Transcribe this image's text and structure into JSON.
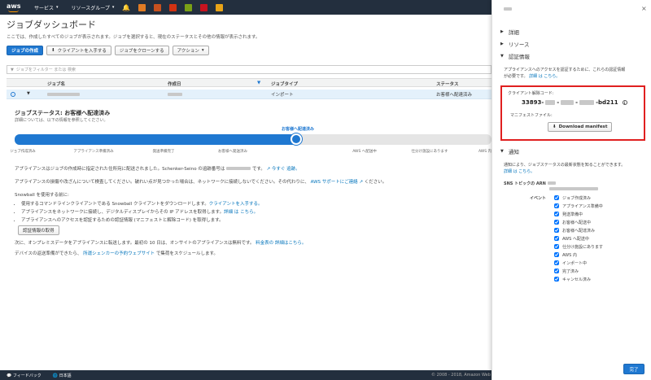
{
  "nav": {
    "services": "サービス",
    "resource_groups": "リソースグループ",
    "service_icon_colors": [
      "#e07b24",
      "#c7511f",
      "#d13212",
      "#7aa116",
      "#c7131f",
      "#e8a317"
    ]
  },
  "page": {
    "title": "ジョブダッシュボード",
    "description": "ここでは、作成したすべてのジョブが表示されます。ジョブを選択すると、現在のステータスとその他の情報が表示されます。",
    "buttons": {
      "create_job": "ジョブの作成",
      "get_client": "クライアントを入手する",
      "clone_job": "ジョブをクローンする",
      "actions": "アクション"
    },
    "filter_placeholder": "ジョブをフィルター または 検索",
    "table": {
      "headers": [
        "ジョブ名",
        "作成日",
        "ジョブタイプ",
        "ステータス"
      ],
      "row": {
        "type": "インポート",
        "status": "お客様へ配達済み"
      }
    }
  },
  "detail": {
    "status_title": "ジョブステータス: お客様へ配達済み",
    "status_sub": "詳細については、以下の情報を参照してください。",
    "current_stage": "お客様へ配達済み",
    "progress_fraction": 0.59,
    "stages": [
      "ジョブ作成済み",
      "アプライアンス準備済み",
      "発送準備完了",
      "お客様へ発送済み",
      "AWS へ配送中",
      "仕分け施設にあります",
      "AWS 内"
    ],
    "para1_a": "アプライアンスはジョブの作成時に指定された住所宛に配送されました。Schenker-Seino の追跡番号は",
    "para1_b": "です。",
    "para1_link1": "今すぐ",
    "para1_link2": "追跡。",
    "para2": "アプライアンスの損傷や改ざんについて検査してください。破れい点が見つかった場合は、ネットワークに接続しないでください。その代わりに、",
    "para2_link": "AWS サポートにご連絡",
    "para2_end": "ください。",
    "before_title": "Snowball を使用する前に:",
    "bullets": [
      {
        "text": "使用するコマンドラインクライアントである Snowball クライアントをダウンロードします。",
        "link": "クライアントを入手する。"
      },
      {
        "text": "アプライアンスをネットワークに接続し、デジタルディスプレイからその IP アドレスを取得します。",
        "link": "詳細 は こちら。"
      },
      {
        "text": "アプライアンスへのアクセスを認証するための認証情報 (マニフェストと解除コード) を取得します。",
        "link": ""
      }
    ],
    "get_credentials": "認証情報の取得",
    "para3": "次に、オンプレミスデータをアプライアンスに転送します。最初の 10 日は、オンサイトのアプライアンスは無料です。",
    "para3_link": "料金表の 詳細はこちら。",
    "para4": "デバイスの返送準備ができたら、",
    "para4_link": "所運シェンカーの予約ウェブサイト",
    "para4_end": "で集荷をスケジュールします。"
  },
  "footer": {
    "feedback": "フィードバック",
    "language": "日本語",
    "copyright": "© 2008 - 2018, Amazon Web Serv"
  },
  "panel": {
    "sections": {
      "details": "詳細",
      "resources": "リソース",
      "credentials": "認証情報",
      "notifications": "通知"
    },
    "cred_text1": "アプライアンスへのアクセスを認証するために、これらの認証情報",
    "cred_text2": "が必要です。",
    "cred_link": "詳細 は こちら。",
    "unlock_label": "クライアント解除コード:",
    "unlock_prefix": "33893-",
    "unlock_suffix": "-bd211",
    "manifest_label": "マニフェストファイル:",
    "download": "Download manifest",
    "notif_text": "通知により、ジョブステータスの最新状態を知ることができます。",
    "notif_link": "詳細 は こちら。",
    "sns_label": "SNS トピックの ARN",
    "events_label": "イベント",
    "events": [
      "ジョブ作成済み",
      "アプライアンス準備中",
      "発送準備中",
      "お客様へ配送中",
      "お客様へ配達済み",
      "AWS へ配送中",
      "仕分け施設にあります",
      "AWS 内",
      "インポート中",
      "完了済み",
      "キャンセル済み"
    ],
    "done": "完了"
  }
}
